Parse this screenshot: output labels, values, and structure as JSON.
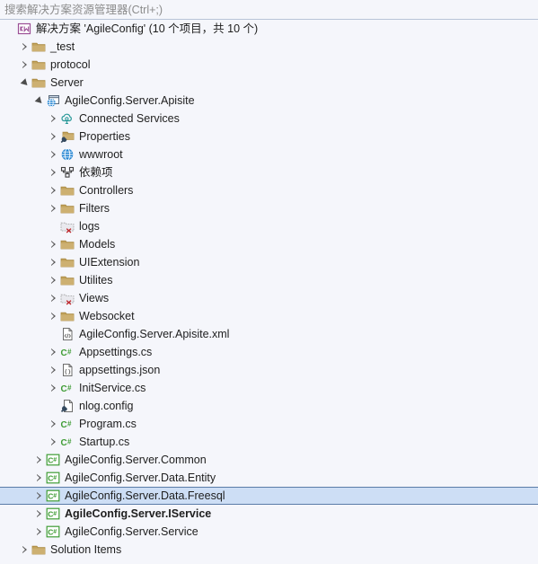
{
  "search": {
    "placeholder": "搜索解决方案资源管理器(Ctrl+;)",
    "value": ""
  },
  "colors": {
    "background": "#f5f6fb",
    "selection_fill": "#cddef5",
    "selection_border": "#5a7ca8",
    "folder": "#c2a35d",
    "csharp_green": "#3f9c35",
    "globe_blue": "#1f82d2",
    "cloud_teal": "#2e9b9b",
    "solution_purple": "#9b4f96",
    "excluded_red": "#c1272d",
    "text": "#1e1e1e",
    "placeholder_text": "#8c8c8c"
  },
  "tree": {
    "rows": [
      {
        "label": "解决方案 'AgileConfig' (10 个项目，共 10 个)",
        "indent": 0,
        "expander": "none",
        "icon": "solution-icon",
        "name": "tree-item-solution-root",
        "bold": false,
        "selected": false
      },
      {
        "label": "_test",
        "indent": 1,
        "expander": "collapsed",
        "icon": "folder-icon",
        "name": "tree-item-_test",
        "bold": false,
        "selected": false
      },
      {
        "label": "protocol",
        "indent": 1,
        "expander": "collapsed",
        "icon": "folder-icon",
        "name": "tree-item-protocol",
        "bold": false,
        "selected": false
      },
      {
        "label": "Server",
        "indent": 1,
        "expander": "expanded",
        "icon": "folder-icon",
        "name": "tree-item-server",
        "bold": false,
        "selected": false
      },
      {
        "label": "AgileConfig.Server.Apisite",
        "indent": 2,
        "expander": "expanded",
        "icon": "web-project-icon",
        "name": "tree-item-agileconfig-server-apisite",
        "bold": false,
        "selected": false
      },
      {
        "label": "Connected Services",
        "indent": 3,
        "expander": "collapsed",
        "icon": "connected-services-icon",
        "name": "tree-item-connected-services",
        "bold": false,
        "selected": false
      },
      {
        "label": "Properties",
        "indent": 3,
        "expander": "collapsed",
        "icon": "properties-folder-icon",
        "name": "tree-item-properties",
        "bold": false,
        "selected": false
      },
      {
        "label": "wwwroot",
        "indent": 3,
        "expander": "collapsed",
        "icon": "globe-icon",
        "name": "tree-item-wwwroot",
        "bold": false,
        "selected": false
      },
      {
        "label": "依赖项",
        "indent": 3,
        "expander": "collapsed",
        "icon": "dependencies-icon",
        "name": "tree-item-dependencies",
        "bold": false,
        "selected": false
      },
      {
        "label": "Controllers",
        "indent": 3,
        "expander": "collapsed",
        "icon": "folder-icon",
        "name": "tree-item-controllers",
        "bold": false,
        "selected": false
      },
      {
        "label": "Filters",
        "indent": 3,
        "expander": "collapsed",
        "icon": "folder-icon",
        "name": "tree-item-filters",
        "bold": false,
        "selected": false
      },
      {
        "label": "logs",
        "indent": 3,
        "expander": "none",
        "icon": "excluded-folder-icon",
        "name": "tree-item-logs",
        "bold": false,
        "selected": false
      },
      {
        "label": "Models",
        "indent": 3,
        "expander": "collapsed",
        "icon": "folder-icon",
        "name": "tree-item-models",
        "bold": false,
        "selected": false
      },
      {
        "label": "UIExtension",
        "indent": 3,
        "expander": "collapsed",
        "icon": "folder-icon",
        "name": "tree-item-uiextension",
        "bold": false,
        "selected": false
      },
      {
        "label": "Utilites",
        "indent": 3,
        "expander": "collapsed",
        "icon": "folder-icon",
        "name": "tree-item-utilites",
        "bold": false,
        "selected": false
      },
      {
        "label": "Views",
        "indent": 3,
        "expander": "collapsed",
        "icon": "excluded-folder-icon",
        "name": "tree-item-views",
        "bold": false,
        "selected": false
      },
      {
        "label": "Websocket",
        "indent": 3,
        "expander": "collapsed",
        "icon": "folder-icon",
        "name": "tree-item-websocket",
        "bold": false,
        "selected": false
      },
      {
        "label": "AgileConfig.Server.Apisite.xml",
        "indent": 3,
        "expander": "none",
        "icon": "xml-file-icon",
        "name": "tree-item-apisite-xml",
        "bold": false,
        "selected": false
      },
      {
        "label": "Appsettings.cs",
        "indent": 3,
        "expander": "collapsed",
        "icon": "csharp-file-icon",
        "name": "tree-item-appsettings-cs",
        "bold": false,
        "selected": false
      },
      {
        "label": "appsettings.json",
        "indent": 3,
        "expander": "collapsed",
        "icon": "json-file-icon",
        "name": "tree-item-appsettings-json",
        "bold": false,
        "selected": false
      },
      {
        "label": "InitService.cs",
        "indent": 3,
        "expander": "collapsed",
        "icon": "csharp-file-icon",
        "name": "tree-item-initservice-cs",
        "bold": false,
        "selected": false
      },
      {
        "label": "nlog.config",
        "indent": 3,
        "expander": "none",
        "icon": "config-file-icon",
        "name": "tree-item-nlog-config",
        "bold": false,
        "selected": false
      },
      {
        "label": "Program.cs",
        "indent": 3,
        "expander": "collapsed",
        "icon": "csharp-file-icon",
        "name": "tree-item-program-cs",
        "bold": false,
        "selected": false
      },
      {
        "label": "Startup.cs",
        "indent": 3,
        "expander": "collapsed",
        "icon": "csharp-file-icon",
        "name": "tree-item-startup-cs",
        "bold": false,
        "selected": false
      },
      {
        "label": "AgileConfig.Server.Common",
        "indent": 2,
        "expander": "collapsed",
        "icon": "csharp-project-icon",
        "name": "tree-item-agileconfig-server-common",
        "bold": false,
        "selected": false
      },
      {
        "label": "AgileConfig.Server.Data.Entity",
        "indent": 2,
        "expander": "collapsed",
        "icon": "csharp-project-icon",
        "name": "tree-item-agileconfig-server-data-entity",
        "bold": false,
        "selected": false
      },
      {
        "label": "AgileConfig.Server.Data.Freesql",
        "indent": 2,
        "expander": "collapsed",
        "icon": "csharp-project-icon",
        "name": "tree-item-agileconfig-server-data-freesql",
        "bold": false,
        "selected": true
      },
      {
        "label": "AgileConfig.Server.IService",
        "indent": 2,
        "expander": "collapsed",
        "icon": "csharp-project-icon",
        "name": "tree-item-agileconfig-server-iservice",
        "bold": true,
        "selected": false
      },
      {
        "label": "AgileConfig.Server.Service",
        "indent": 2,
        "expander": "collapsed",
        "icon": "csharp-project-icon",
        "name": "tree-item-agileconfig-server-service",
        "bold": false,
        "selected": false
      },
      {
        "label": "Solution Items",
        "indent": 1,
        "expander": "collapsed",
        "icon": "folder-icon",
        "name": "tree-item-solution-items",
        "bold": false,
        "selected": false
      }
    ]
  }
}
